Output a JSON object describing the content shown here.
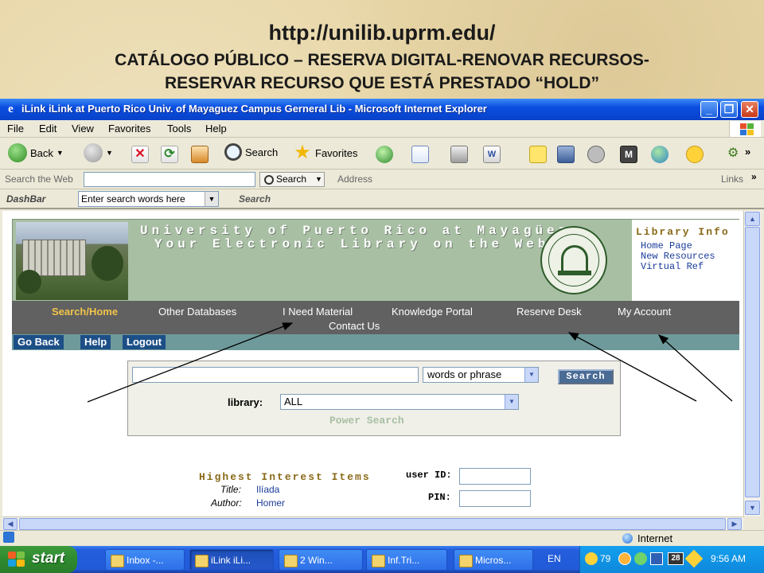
{
  "slide": {
    "url": "http://unilib.uprm.edu/",
    "line1": "CATÁLOGO PÚBLICO – RESERVA DIGITAL-RENOVAR RECURSOS-",
    "line2": "RESERVAR RECURSO QUE ESTÁ PRESTADO “HOLD”"
  },
  "window": {
    "title": "iLink iLink at Puerto Rico Univ. of Mayaguez Campus Gerneral Lib - Microsoft Internet Explorer",
    "menu": [
      "File",
      "Edit",
      "View",
      "Favorites",
      "Tools",
      "Help"
    ],
    "toolbar": {
      "back": "Back",
      "search": "Search",
      "favorites": "Favorites"
    },
    "searchbar": {
      "label": "Search the Web",
      "button": "Search",
      "address": "Address",
      "links": "Links"
    },
    "dashbar": {
      "label": "DashBar",
      "placeholder": "Enter search words here",
      "search": "Search"
    },
    "status": {
      "zone": "Internet"
    }
  },
  "taskbar": {
    "start": "start",
    "tasks": [
      "Inbox -...",
      "iLink iLi...",
      "2 Win...",
      "Inf.Tri...",
      "Micros..."
    ],
    "lang": "EN",
    "temp": "79",
    "date_badge": "28",
    "clock": "9:56 AM"
  },
  "page": {
    "banner": {
      "name": "University of Puerto Rico at Mayagüez",
      "tagline": "Your Electronic Library on the Web"
    },
    "library_info": {
      "heading": "Library Info",
      "links": [
        "Home Page",
        "New Resources",
        "Virtual Ref"
      ]
    },
    "nav": {
      "items": [
        "Search/Home",
        "Other Databases",
        "I Need Material",
        "Knowledge Portal",
        "Reserve Desk",
        "My Account"
      ],
      "contact": "Contact Us"
    },
    "subnav": [
      "Go Back",
      "Help",
      "Logout"
    ],
    "search": {
      "mode": "words or phrase",
      "button": "Search",
      "library_label": "library:",
      "library_value": "ALL",
      "power": "Power Search"
    },
    "highest_interest": {
      "title": "Highest Interest Items",
      "title_label": "Title:",
      "title_value": "Ilíada",
      "author_label": "Author:",
      "author_value": "Homer"
    },
    "login": {
      "user_label": "user ID:",
      "pin_label": "PIN:"
    }
  },
  "colors": {
    "banner_green": "#a8bfa4",
    "nav_gray": "#616161",
    "nav_active": "#f1c44a",
    "subnav_teal": "#6f9a9b",
    "pill_blue": "#1d4f87",
    "heading_gold": "#8a6a1a"
  }
}
